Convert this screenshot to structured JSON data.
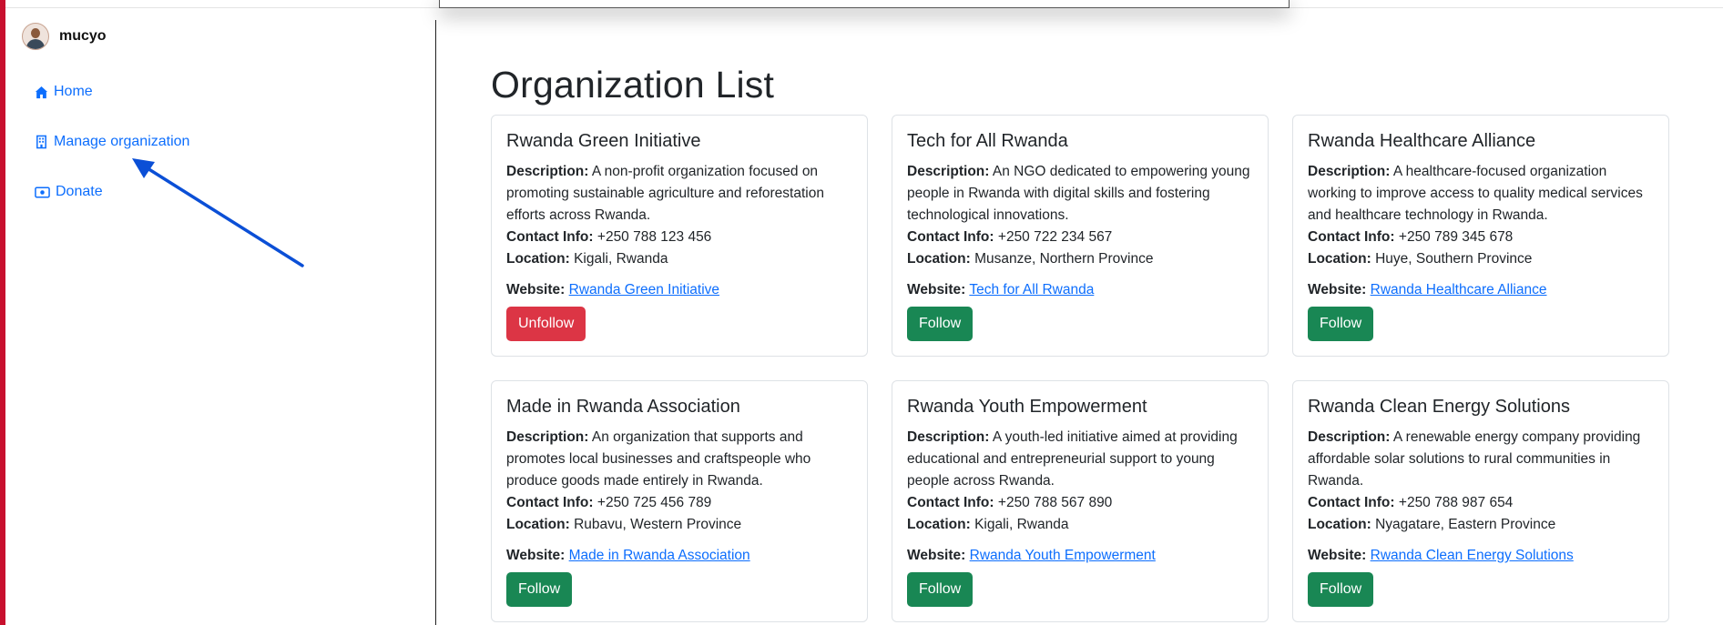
{
  "sidebar": {
    "username": "mucyo",
    "items": [
      {
        "label": "Home",
        "icon": "house-icon"
      },
      {
        "label": "Manage organization",
        "icon": "building-icon"
      },
      {
        "label": "Donate",
        "icon": "cash-icon"
      }
    ]
  },
  "main": {
    "title": "Organization List",
    "labels": {
      "description": "Description:",
      "contact": "Contact Info:",
      "location": "Location:",
      "website": "Website:"
    },
    "cards": [
      {
        "name": "Rwanda Green Initiative",
        "description": "A non-profit organization focused on promoting sustainable agriculture and reforestation efforts across Rwanda.",
        "contact": "+250 788 123 456",
        "location": "Kigali, Rwanda",
        "website": "Rwanda Green Initiative",
        "button": "Unfollow",
        "button_color": "#dc3545"
      },
      {
        "name": "Tech for All Rwanda",
        "description": "An NGO dedicated to empowering young people in Rwanda with digital skills and fostering technological innovations.",
        "contact": "+250 722 234 567",
        "location": "Musanze, Northern Province",
        "website": "Tech for All Rwanda",
        "button": "Follow",
        "button_color": "#198754"
      },
      {
        "name": "Rwanda Healthcare Alliance",
        "description": "A healthcare-focused organization working to improve access to quality medical services and healthcare technology in Rwanda.",
        "contact": "+250 789 345 678",
        "location": "Huye, Southern Province",
        "website": "Rwanda Healthcare Alliance",
        "button": "Follow",
        "button_color": "#198754"
      },
      {
        "name": "Made in Rwanda Association",
        "description": "An organization that supports and promotes local businesses and craftspeople who produce goods made entirely in Rwanda.",
        "contact": "+250 725 456 789",
        "location": "Rubavu, Western Province",
        "website": "Made in Rwanda Association",
        "button": "Follow",
        "button_color": "#198754"
      },
      {
        "name": "Rwanda Youth Empowerment",
        "description": "A youth-led initiative aimed at providing educational and entrepreneurial support to young people across Rwanda.",
        "contact": "+250 788 567 890",
        "location": "Kigali, Rwanda",
        "website": "Rwanda Youth Empowerment",
        "button": "Follow",
        "button_color": "#198754"
      },
      {
        "name": "Rwanda Clean Energy Solutions",
        "description": "A renewable energy company providing affordable solar solutions to rural communities in Rwanda.",
        "contact": "+250 788 987 654",
        "location": "Nyagatare, Eastern Province",
        "website": "Rwanda Clean Energy Solutions",
        "button": "Follow",
        "button_color": "#198754"
      }
    ]
  },
  "colors": {
    "accent": "#0d6efd",
    "stripe": "#c8102e",
    "arrow": "#0b4fd6"
  }
}
